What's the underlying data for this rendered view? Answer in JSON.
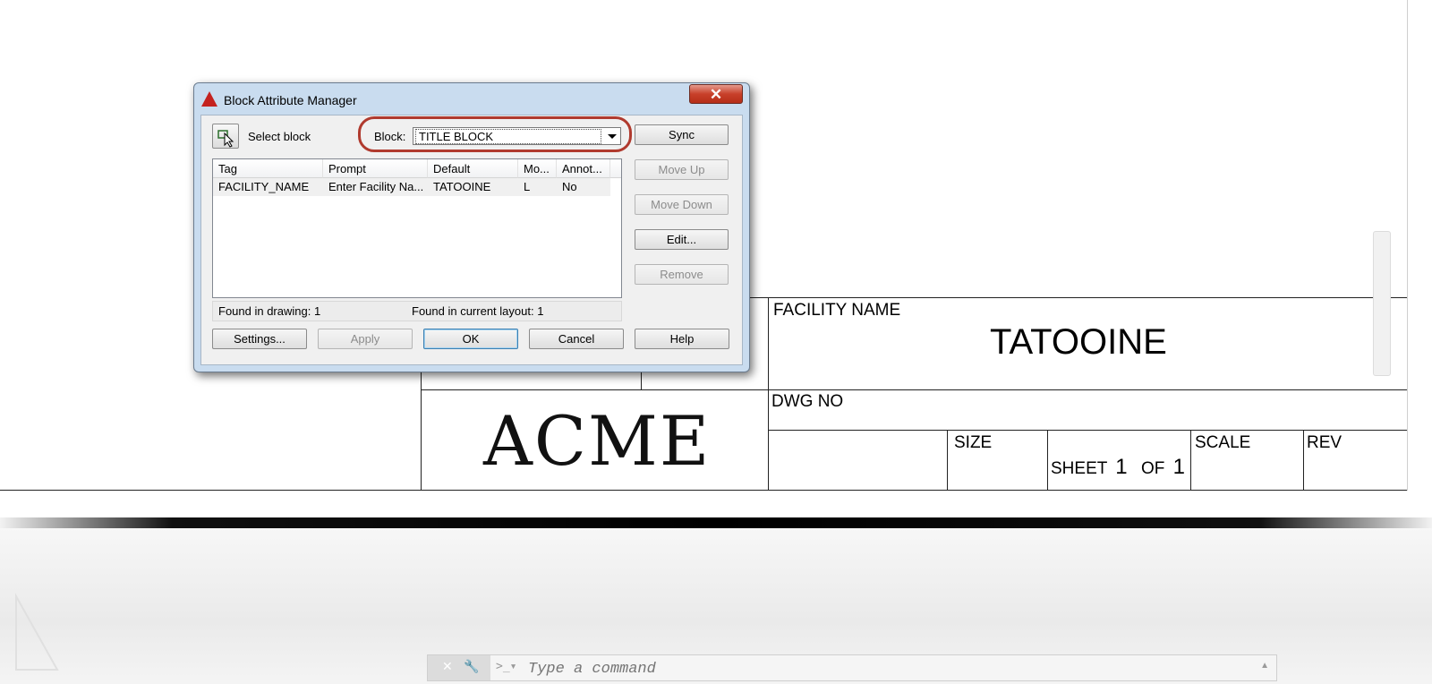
{
  "window": {
    "title": "Block Attribute Manager"
  },
  "select_block": {
    "label": "Select block"
  },
  "block": {
    "label": "Block:",
    "value": "TITLE BLOCK"
  },
  "side_buttons": {
    "sync": "Sync",
    "move_up": "Move Up",
    "move_down": "Move Down",
    "edit": "Edit...",
    "remove": "Remove"
  },
  "attributes": {
    "columns": [
      "Tag",
      "Prompt",
      "Default",
      "Mo...",
      "Annot..."
    ],
    "rows": [
      {
        "tag": "FACILITY_NAME",
        "prompt": "Enter Facility Na...",
        "default": "TATOOINE",
        "mode": "L",
        "annotative": "No"
      }
    ]
  },
  "status": {
    "found_drawing": "Found in drawing: 1",
    "found_layout": "Found in current layout: 1"
  },
  "bottom_buttons": {
    "settings": "Settings...",
    "apply": "Apply",
    "ok": "OK",
    "cancel": "Cancel",
    "help": "Help"
  },
  "title_block": {
    "facility_label": "FACILITY NAME",
    "facility_value": "TATOOINE",
    "company": "ACME",
    "dwg_no_label": "DWG NO",
    "size_label": "SIZE",
    "sheet_label": "SHEET",
    "sheet_num": "1",
    "of_label": "OF",
    "sheet_total": "1",
    "scale_label": "SCALE",
    "rev_label": "REV"
  },
  "command_line": {
    "placeholder": "Type a command"
  },
  "colors": {
    "highlight": "#b03a2e",
    "close_button": "#c8402a",
    "dialog_frame": "#c9dcef"
  }
}
